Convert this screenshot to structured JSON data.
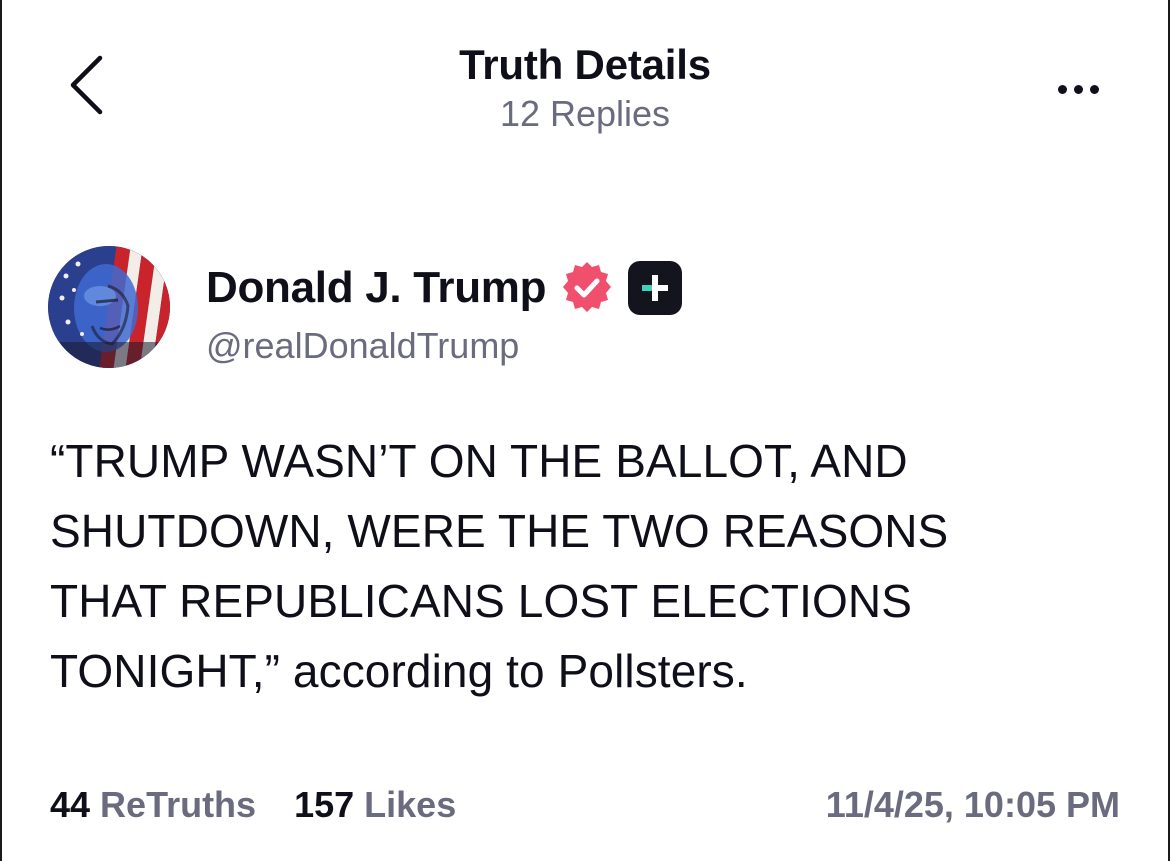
{
  "header": {
    "title": "Truth Details",
    "subtitle": "12 Replies",
    "back_icon": "chevron-left-icon",
    "more_icon": "ellipsis-icon"
  },
  "author": {
    "display_name": "Donald J. Trump",
    "handle": "@realDonaldTrump",
    "verified_color": "#f0506e",
    "verified_icon": "verified-check-icon",
    "plus_icon": "plus-badge-icon"
  },
  "post": {
    "lines": [
      "“TRUMP WASN’T ON THE BALLOT, AND",
      "SHUTDOWN, WERE THE TWO REASONS",
      "THAT REPUBLICANS LOST ELECTIONS",
      "TONIGHT,” according to Pollsters."
    ]
  },
  "stats": {
    "retruths_count": "44",
    "retruths_label": "ReTruths",
    "likes_count": "157",
    "likes_label": "Likes",
    "timestamp": "11/4/25, 10:05 PM"
  },
  "colors": {
    "primary_text": "#0f0f1a",
    "secondary_text": "#6b6b80",
    "accent_pink": "#f0506e",
    "plus_badge_bg": "#14141f",
    "plus_badge_accent": "#3fd0b5"
  }
}
